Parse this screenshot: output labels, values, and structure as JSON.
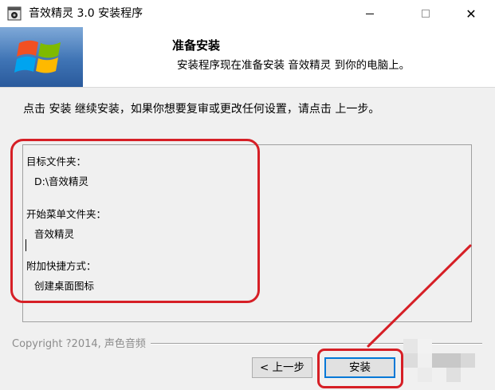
{
  "window": {
    "title": "音效精灵 3.0 安装程序",
    "controls": {
      "minimize": "minimize",
      "maximize": "maximize",
      "close": "✕"
    }
  },
  "header": {
    "title": "准备安装",
    "subtitle": "安装程序现在准备安装 音效精灵 到你的电脑上。"
  },
  "body": {
    "instruction": "点击 安装 继续安装，如果你想要复审或更改任何设置，请点击 上一步。"
  },
  "memo": {
    "lines": [
      "目标文件夹：",
      "D:\\音效精灵",
      "开始菜单文件夹：",
      "音效精灵",
      "附加快捷方式：",
      "创建桌面图标"
    ]
  },
  "footer": {
    "copyright": "Copyright ?2014, 声色音频"
  },
  "buttons": {
    "back": "< 上一步",
    "install": "安装"
  },
  "colors": {
    "annotation_red": "#d61f26",
    "focus_blue": "#0078d7",
    "banner_blue": "#3f74b5"
  }
}
